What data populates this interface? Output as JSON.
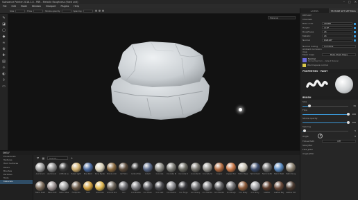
{
  "window": {
    "title": "Substance Painter 2018.1.0 - PBR - Metallic Roughness (fixed unit)",
    "controls": [
      "–",
      "□",
      "✕"
    ]
  },
  "menu": [
    "File",
    "Edit",
    "Mode",
    "Window",
    "Viewport",
    "Plugins",
    "Help"
  ],
  "toolbar": {
    "size_label": "Size",
    "flow_label": "Flow",
    "stroke_label": "Stroke opacity",
    "spacing_label": "Spacing"
  },
  "viewport": {
    "mode_select": "Material"
  },
  "right_panel": {
    "tabs": [
      "LAYERS",
      "TEXTURE SET SETTINGS"
    ],
    "set_name": "DEFAULT",
    "channels_label": "Channels",
    "channels": [
      {
        "name": "Base color",
        "format": "sRGB8"
      },
      {
        "name": "Height",
        "format": "L16F"
      },
      {
        "name": "Roughness",
        "format": "L8"
      },
      {
        "name": "Metallic",
        "format": "L8"
      },
      {
        "name": "Normal",
        "format": "RGB16F"
      }
    ],
    "normal_mixing_label": "Normal mixing",
    "normal_mixing_value": "Combine",
    "ao_label": "Ambient occlusion map",
    "mesh_maps_label": "Mesh maps",
    "bake_button": "Bake Mesh Maps",
    "material_name": "Normal",
    "material_sub": "Normal Map from ... Default Material",
    "world_space_label": "World space normal",
    "properties_title": "PROPERTIES - PAINT",
    "brush_section": "BRUSH",
    "sliders": [
      {
        "label": "Size",
        "value": "15",
        "fill": 0.15
      },
      {
        "label": "Flow",
        "value": "100",
        "fill": 1.0
      },
      {
        "label": "Stroke opacity",
        "value": "100",
        "fill": 1.0
      },
      {
        "label": "Spacing",
        "value": "5",
        "fill": 0.05
      },
      {
        "label": "Angle",
        "value": "0",
        "fill": 0.0
      }
    ],
    "follow_path_label": "Follow Path",
    "follow_path_value": "Off",
    "size_jitter_label": "Size Jitter",
    "flow_jitter_label": "Flow Jitter",
    "angle_jitter_label": "Angle Jitter"
  },
  "shelf": {
    "title": "SHELF",
    "categories": [
      "Procedurals",
      "Textures",
      "Hard Surfaces",
      "Filters",
      "Brushes",
      "Particles",
      "Tools",
      "Materials"
    ],
    "active_category": "Materials",
    "filter_placeholder": "Search...",
    "materials": [
      {
        "name": "Aluminium",
        "color": "#9a9a9a"
      },
      {
        "name": "Aluminium Rough",
        "color": "#8a8a8a"
      },
      {
        "name": "Artificial Leather",
        "color": "#3a3a3a"
      },
      {
        "name": "Baked Light",
        "color": "#d0b070"
      },
      {
        "name": "Blue Paint",
        "color": "#4a6aa0"
      },
      {
        "name": "Bone Stylized",
        "color": "#d8d0b8"
      },
      {
        "name": "Bronze Armor",
        "color": "#8a6a40"
      },
      {
        "name": "Calf Skin",
        "color": "#5a4a3a"
      },
      {
        "name": "Carbon Fiber",
        "color": "#2a2a2a"
      },
      {
        "name": "Cobalt",
        "color": "#5a6a8a"
      },
      {
        "name": "Concrete",
        "color": "#8a8a84"
      },
      {
        "name": "Concrete Bare",
        "color": "#7a7a74"
      },
      {
        "name": "Concrete Dirty",
        "color": "#6a6a62"
      },
      {
        "name": "Concrete Old",
        "color": "#76746c"
      },
      {
        "name": "Concrete Smooth",
        "color": "#9a9892"
      },
      {
        "name": "Copper",
        "color": "#b06a40"
      },
      {
        "name": "Copper Pure",
        "color": "#c87848"
      },
      {
        "name": "Fabric Baseball",
        "color": "#c8c2b4"
      },
      {
        "name": "Fabric Denim",
        "color": "#3a4a6a"
      },
      {
        "name": "Fabric Knitted",
        "color": "#6a6a6a"
      },
      {
        "name": "Fabric Plastic",
        "color": "#5a8ac0"
      },
      {
        "name": "Fabric Rough",
        "color": "#8a8070"
      },
      {
        "name": "Fabric Suede",
        "color": "#7a6a5a"
      },
      {
        "name": "Fabric Soft",
        "color": "#9a9090"
      },
      {
        "name": "Fabric Sheer",
        "color": "#a0a0a0"
      },
      {
        "name": "Footprints",
        "color": "#6a5a4a"
      },
      {
        "name": "Gold",
        "color": "#d0a040"
      },
      {
        "name": "Gold Pure",
        "color": "#e0b850"
      },
      {
        "name": "Ground Grav",
        "color": "#6a6258"
      },
      {
        "name": "Iron",
        "color": "#6a6a6e"
      },
      {
        "name": "Iron Brushed",
        "color": "#7a7a7e"
      },
      {
        "name": "Iron Chain",
        "color": "#5a5a5e"
      },
      {
        "name": "Iron Cast",
        "color": "#4a4a4e"
      },
      {
        "name": "Iron Diamond",
        "color": "#8a8a8e"
      },
      {
        "name": "Iron Forge",
        "color": "#3a3a3e"
      },
      {
        "name": "Iron Grainy",
        "color": "#6e6e70"
      },
      {
        "name": "Iron Hammered",
        "color": "#7e7e80"
      },
      {
        "name": "Iron Powder",
        "color": "#5e5e60"
      },
      {
        "name": "Iron Rough",
        "color": "#707072"
      },
      {
        "name": "Iron Rusty",
        "color": "#8a5a3a"
      },
      {
        "name": "Iron Shiny",
        "color": "#a0a0a4"
      },
      {
        "name": "Leather",
        "color": "#5a3a2a"
      },
      {
        "name": "Leather Bag",
        "color": "#6a4a3a"
      },
      {
        "name": "Leather Old",
        "color": "#4a3a30"
      }
    ]
  }
}
